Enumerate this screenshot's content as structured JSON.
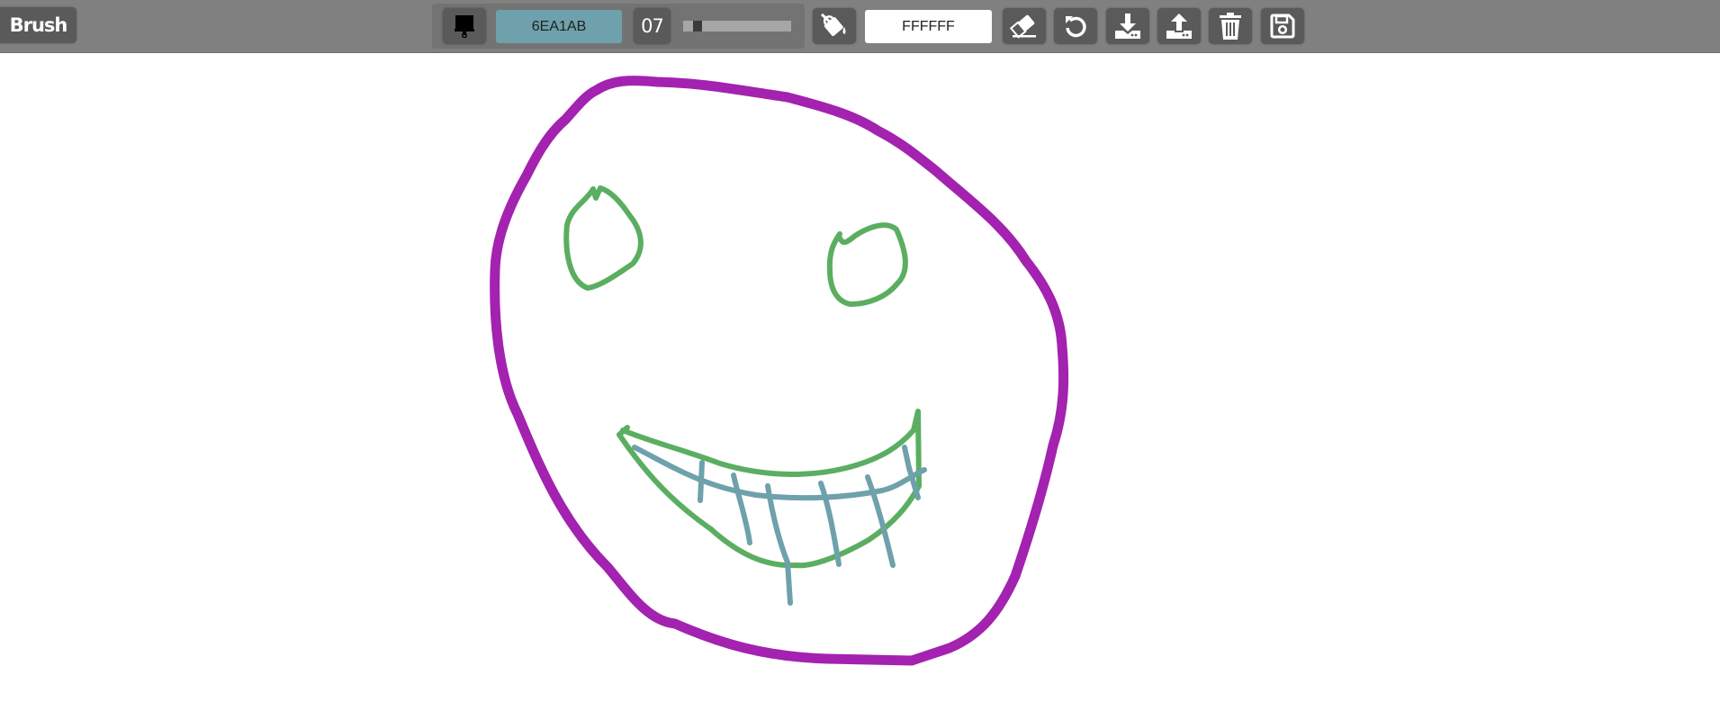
{
  "toolbar": {
    "mode_label": "Brush",
    "brush_color": "6EA1AB",
    "brush_size": "07",
    "brush_size_fraction": 0.1,
    "background_color": "FFFFFF"
  },
  "icons": {
    "brush": "paint-brush-icon",
    "fill": "fill-bucket-icon",
    "eraser": "eraser-icon",
    "undo": "undo-icon",
    "download": "download-icon",
    "upload": "upload-icon",
    "clear": "trash-icon",
    "save": "save-icon"
  },
  "drawing": {
    "colors": {
      "face": "#A322B0",
      "eyes_mouth": "#5BAE61",
      "teeth": "#6EA1AB"
    }
  }
}
